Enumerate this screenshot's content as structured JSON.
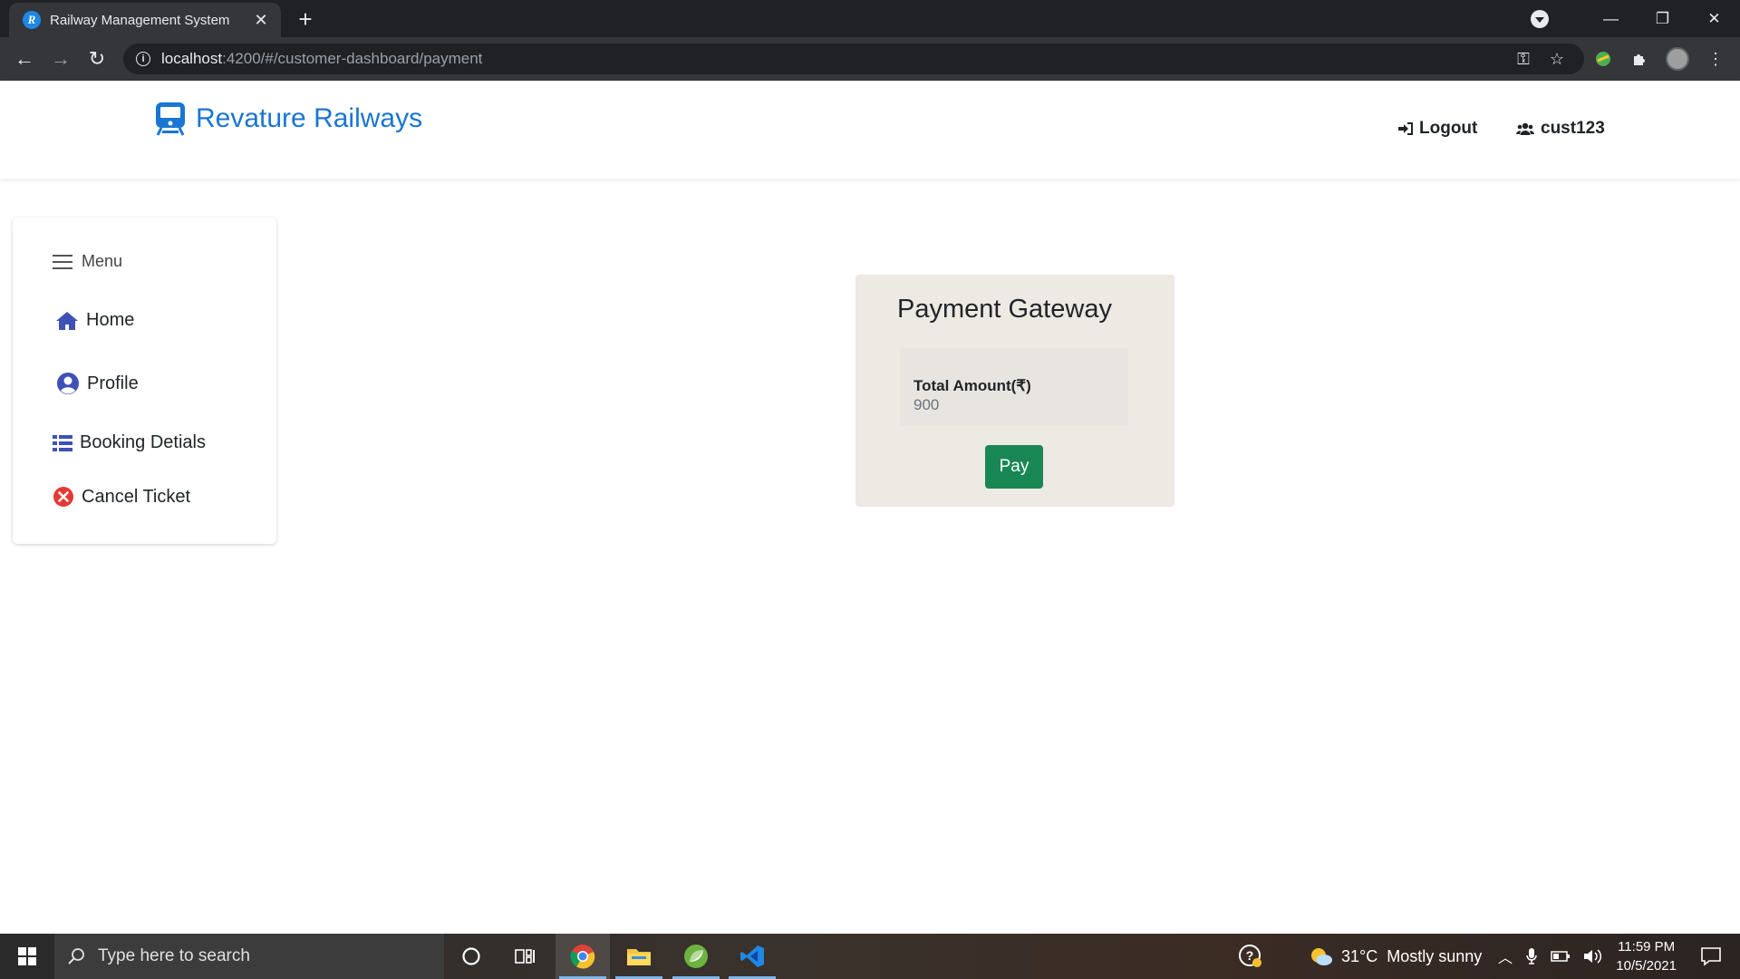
{
  "browser": {
    "tab_title": "Railway Management System",
    "tab_favicon_letter": "R",
    "url_host": "localhost",
    "url_path": ":4200/#/customer-dashboard/payment"
  },
  "header": {
    "brand": "Revature Railways",
    "logout_label": "Logout",
    "username": "cust123",
    "brand_color": "#1976d2"
  },
  "sidebar": {
    "menu_label": "Menu",
    "items": [
      {
        "label": "Home",
        "icon": "home-icon"
      },
      {
        "label": "Profile",
        "icon": "user-circle-icon"
      },
      {
        "label": "Booking Detials",
        "icon": "list-icon"
      },
      {
        "label": "Cancel Ticket",
        "icon": "cancel-circle-icon"
      }
    ]
  },
  "payment": {
    "title": "Payment Gateway",
    "amount_label": "Total Amount(₹)",
    "amount_value": "900",
    "pay_label": "Pay",
    "pay_color": "#198754"
  },
  "taskbar": {
    "search_placeholder": "Type here to search",
    "weather_temp": "31°C",
    "weather_desc": "Mostly sunny",
    "time": "11:59 PM",
    "date": "10/5/2021"
  }
}
